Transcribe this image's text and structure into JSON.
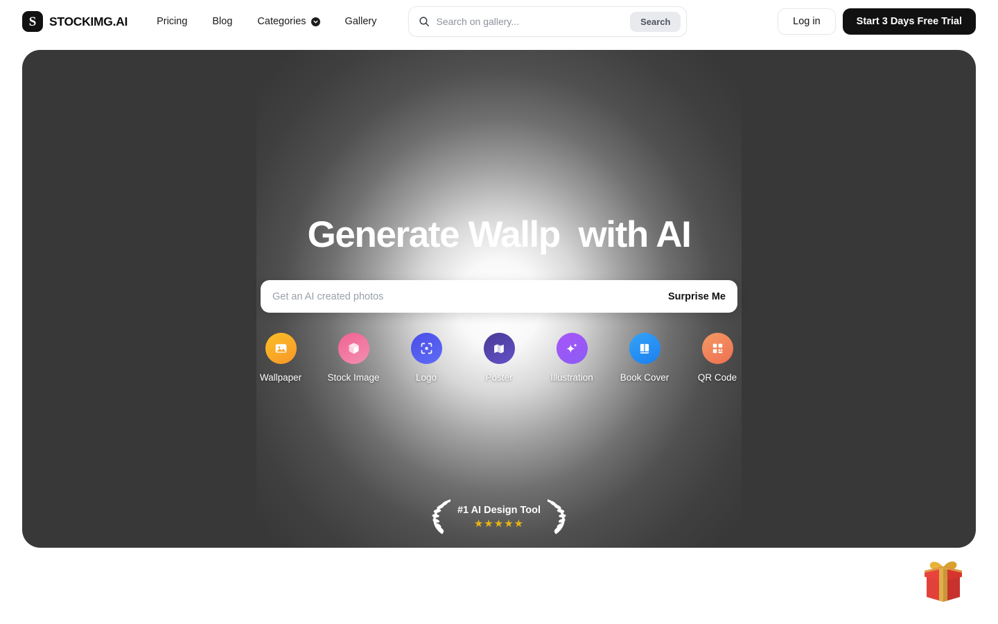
{
  "header": {
    "brand": {
      "mark": "S",
      "name": "STOCKIMG.AI",
      "logo_icon": "stockimg-logo-icon"
    },
    "nav": [
      {
        "label": "Pricing",
        "has_dropdown": false
      },
      {
        "label": "Blog",
        "has_dropdown": false
      },
      {
        "label": "Categories",
        "has_dropdown": true,
        "icon": "chevron-down-icon"
      },
      {
        "label": "Gallery",
        "has_dropdown": false
      }
    ],
    "search": {
      "icon": "search-icon",
      "placeholder": "Search on gallery...",
      "value": "",
      "button_label": "Search"
    },
    "login_label": "Log in",
    "trial_label": "Start 3 Days Free Trial"
  },
  "hero": {
    "background_color": "#383838",
    "glow_color": "#ffffff",
    "title": "Generate Wallp  with AI",
    "prompt": {
      "placeholder": "Get an AI created photos",
      "value": "",
      "action_label": "Surprise Me"
    },
    "categories": [
      {
        "label": "Wallpaper",
        "icon": "image-icon",
        "color_from": "#fbbf24",
        "color_to": "#f79b2c"
      },
      {
        "label": "Stock Image",
        "icon": "box-icon",
        "color_from": "#f2698f",
        "color_to": "#ef7fa8"
      },
      {
        "label": "Logo",
        "icon": "focus-icon",
        "color_from": "#4f52e8",
        "color_to": "#5b6ef5"
      },
      {
        "label": "Poster",
        "icon": "map-icon",
        "color_from": "#4b3b96",
        "color_to": "#5f4fc4"
      },
      {
        "label": "Illustration",
        "icon": "sparkle-icon",
        "color_from": "#9f52f0",
        "color_to": "#8b5cf6"
      },
      {
        "label": "Book Cover",
        "icon": "book-icon",
        "color_from": "#2f9bf5",
        "color_to": "#1e86f0"
      },
      {
        "label": "QR Code",
        "icon": "qr-code-icon",
        "color_from": "#f2945f",
        "color_to": "#ef7254"
      }
    ],
    "badge": {
      "title": "#1 AI Design Tool",
      "stars": "★★★★★",
      "star_count": 5,
      "star_color": "#e8b413",
      "left_icon": "laurel-left-icon",
      "right_icon": "laurel-right-icon"
    }
  },
  "floating": {
    "gift_icon": "gift-box-icon"
  }
}
